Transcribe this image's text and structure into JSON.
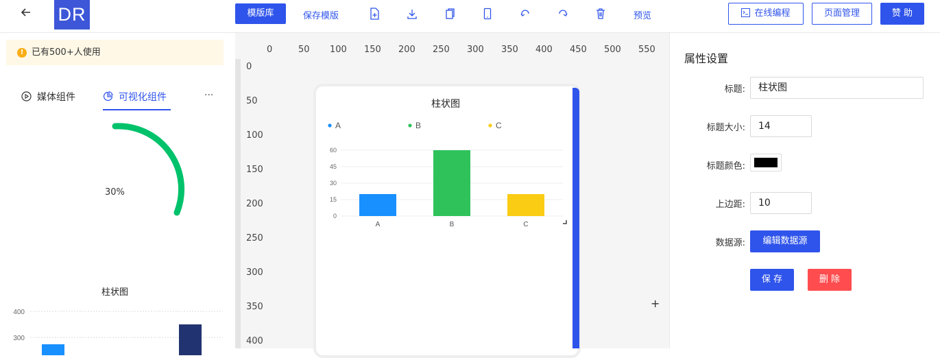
{
  "header": {
    "logo_text": "DR",
    "template_lib": "模版库",
    "save_template": "保存模版",
    "preview": "预览",
    "online_code": "在线编程",
    "page_manage": "页面管理",
    "sponsor": "赞 助",
    "icons": [
      "new-page-icon",
      "download-icon",
      "copy-icon",
      "mobile-icon",
      "undo-icon",
      "redo-icon",
      "delete-icon"
    ]
  },
  "left": {
    "notice": "已有500+人使用",
    "tabs": [
      "媒体组件",
      "可视化组件"
    ],
    "more": "···",
    "gauge_label": "30%",
    "gauge_value": 30,
    "mini_chart_title": "柱状图",
    "mini_chart_ticks": [
      "400",
      "300"
    ]
  },
  "canvas": {
    "ruler_x": [
      "0",
      "50",
      "100",
      "150",
      "200",
      "250",
      "300",
      "350",
      "400",
      "450",
      "500",
      "550"
    ],
    "ruler_y": [
      "0",
      "50",
      "100",
      "150",
      "200",
      "250",
      "300",
      "350",
      "400"
    ],
    "plus": "+"
  },
  "chart_data": {
    "type": "bar",
    "title": "柱状图",
    "categories": [
      "A",
      "B",
      "C"
    ],
    "values": [
      20,
      60,
      20
    ],
    "legend": [
      "A",
      "B",
      "C"
    ],
    "colors": [
      "#1890ff",
      "#2fc25b",
      "#facc14"
    ],
    "ylim": [
      0,
      60
    ],
    "yticks": [
      "0",
      "15",
      "30",
      "45",
      "60"
    ],
    "legend_position": "top"
  },
  "props": {
    "panel_title": "属性设置",
    "title_label": "标题:",
    "title_value": "柱状图",
    "title_size_label": "标题大小:",
    "title_size_value": "14",
    "title_color_label": "标题颜色:",
    "title_color_value": "#000000",
    "top_margin_label": "上边距:",
    "top_margin_value": "10",
    "datasource_label": "数据源:",
    "edit_datasource": "编辑数据源",
    "save": "保 存",
    "delete": "删 除"
  }
}
